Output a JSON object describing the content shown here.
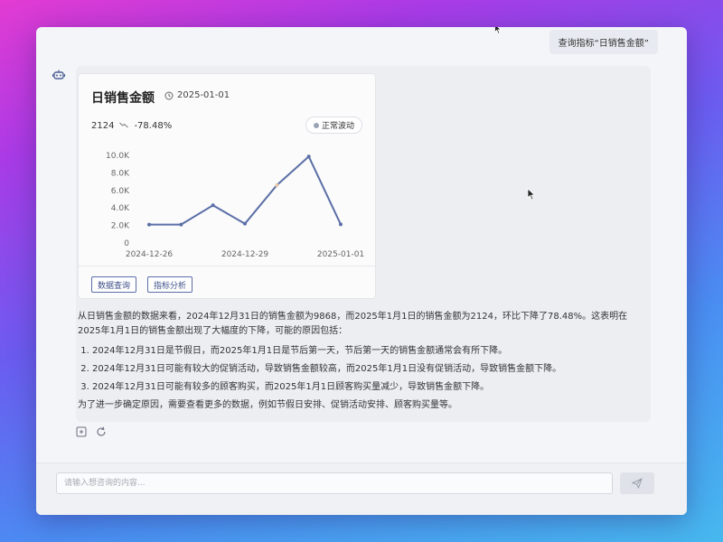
{
  "user_message": "查询指标“日销售金额”",
  "card": {
    "title": "日销售金额",
    "date": "2025-01-01",
    "value": "2124",
    "change": "-78.48%",
    "status_badge": "正常波动",
    "buttons": {
      "data_query": "数据查询",
      "metric_analysis": "指标分析"
    }
  },
  "chart_data": {
    "type": "line",
    "x": [
      "2024-12-26",
      "2024-12-27",
      "2024-12-28",
      "2024-12-29",
      "2024-12-30",
      "2024-12-31",
      "2025-01-01"
    ],
    "values": [
      2100,
      2100,
      4300,
      2200,
      6600,
      9868,
      2124
    ],
    "x_tick_labels": [
      "2024-12-26",
      "2024-12-29",
      "2025-01-01"
    ],
    "y_tick_labels": [
      "0",
      "2.0K",
      "4.0K",
      "6.0K",
      "8.0K",
      "10.0K"
    ],
    "ylim": [
      0,
      10000
    ],
    "title": "",
    "xlabel": "",
    "ylabel": "",
    "grid": false,
    "colors": {
      "line": "#5b6fa6",
      "point": "#5b6fa6",
      "highlight_point": "#e3c9a8"
    }
  },
  "answer": {
    "intro": "从日销售金额的数据来看，2024年12月31日的销售金额为9868，而2025年1月1日的销售金额为2124，环比下降了78.48%。这表明在2025年1月1日的销售金额出现了大幅度的下降，可能的原因包括：",
    "reasons": [
      "2024年12月31日是节假日，而2025年1月1日是节后第一天，节后第一天的销售金额通常会有所下降。",
      "2024年12月31日可能有较大的促销活动，导致销售金额较高，而2025年1月1日没有促销活动，导致销售金额下降。",
      "2024年12月31日可能有较多的顾客购买，而2025年1月1日顾客购买量减少，导致销售金额下降。"
    ],
    "conclusion": "为了进一步确定原因，需要查看更多的数据，例如节假日安排、促销活动安排、顾客购买量等。"
  },
  "input": {
    "placeholder": "请输入想咨询的内容..."
  },
  "icons": {
    "bot_avatar": "robot-icon",
    "date": "clock-icon",
    "trend": "trend-down-icon",
    "status": "status-icon",
    "copy": "copy-icon",
    "refresh": "refresh-icon",
    "send": "send-icon"
  },
  "colors": {
    "accent": "#3c4f88",
    "panel_bg": "#eceef2"
  }
}
